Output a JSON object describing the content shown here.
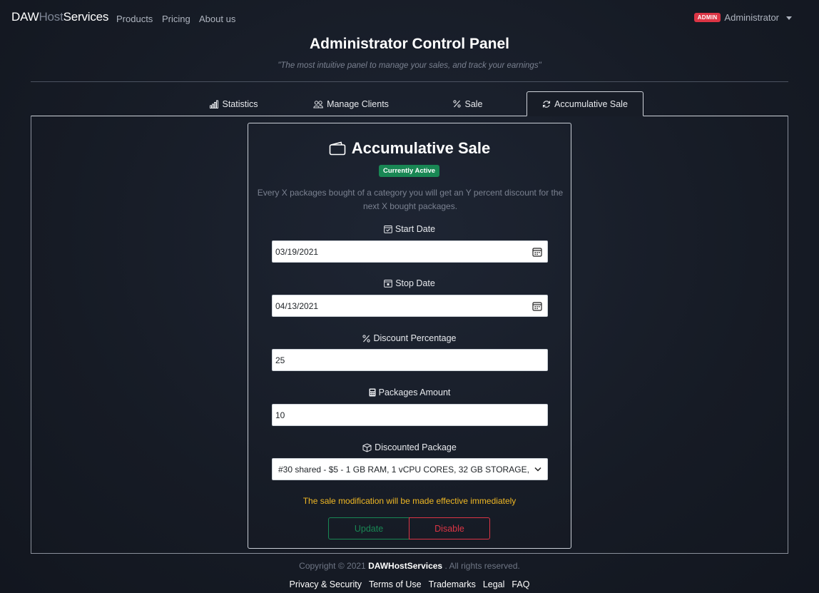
{
  "navbar": {
    "brand_part1": "DAW",
    "brand_part2": "Host",
    "brand_part3": "Services",
    "links": [
      "Products",
      "Pricing",
      "About us"
    ],
    "admin_badge": "ADMIN",
    "user_name": "Administrator"
  },
  "header": {
    "title": "Administrator Control Panel",
    "subtitle": "\"The most intuitive panel to manage your sales, and track your earnings\""
  },
  "tabs": [
    {
      "label": "Statistics",
      "icon": "bar-chart-icon"
    },
    {
      "label": "Manage Clients",
      "icon": "people-icon"
    },
    {
      "label": "Sale",
      "icon": "percent-icon"
    },
    {
      "label": "Accumulative Sale",
      "icon": "refresh-icon",
      "active": true
    }
  ],
  "card": {
    "title": "Accumulative Sale",
    "status": "Currently Active",
    "description": "Every X packages bought of a category you will get an Y percent discount for the next X bought packages.",
    "start_date_label": "Start Date",
    "start_date_value": "03/19/2021",
    "stop_date_label": "Stop Date",
    "stop_date_value": "04/13/2021",
    "discount_label": "Discount Percentage",
    "discount_value": "25",
    "packages_label": "Packages Amount",
    "packages_value": "10",
    "package_label": "Discounted Package",
    "package_value": "#30 shared - $5 - 1 GB RAM, 1 vCPU CORES, 32 GB STORAGE,",
    "notice": "The sale modification will be made effective immediately",
    "update_label": "Update",
    "disable_label": "Disable"
  },
  "footer": {
    "copyright_prefix": "Copyright © 2021",
    "copyright_brand": "DAWHostServices",
    "copyright_suffix": ". All rights reserved.",
    "links": [
      "Privacy & Security",
      "Terms of Use",
      "Trademarks",
      "Legal",
      "FAQ"
    ]
  },
  "colors": {
    "background": "#161b25",
    "success": "#198754",
    "danger": "#dc3545",
    "warning": "#f0b824"
  }
}
